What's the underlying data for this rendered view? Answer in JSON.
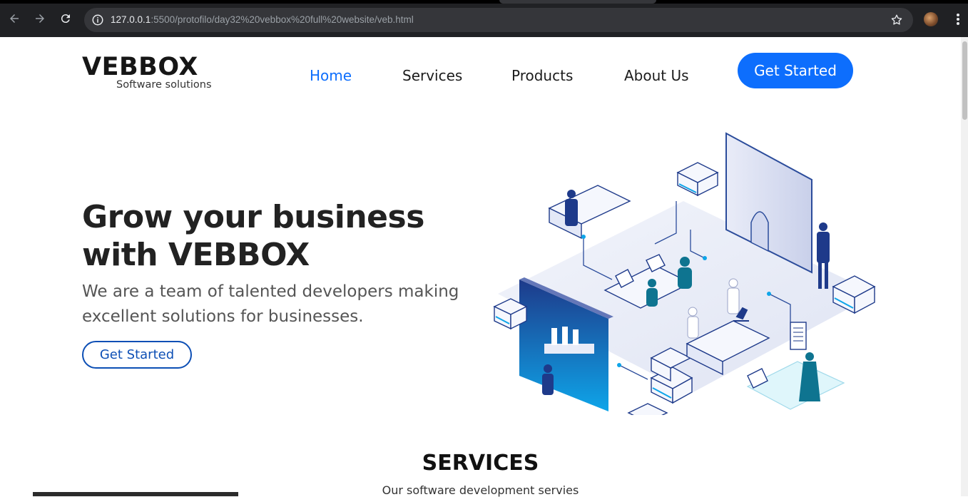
{
  "browser": {
    "url_host": "127.0.0.1",
    "url_rest": ":5500/protofilo/day32%20vebbox%20full%20website/veb.html",
    "icons": [
      "back-icon",
      "forward-icon",
      "reload-icon",
      "site-info-icon",
      "bookmark-star-icon",
      "profile-avatar",
      "menu-kebab-icon"
    ]
  },
  "logo": {
    "title": "VEBBOX",
    "subtitle": "Software solutions"
  },
  "nav": {
    "items": [
      {
        "label": "Home",
        "active": true
      },
      {
        "label": "Services",
        "active": false
      },
      {
        "label": "Products",
        "active": false
      },
      {
        "label": "About Us",
        "active": false
      }
    ],
    "cta": "Get Started"
  },
  "hero": {
    "title_line1": "Grow your business",
    "title_line2": "with VEBBOX",
    "subtitle": "We are a team of talented developers making excellent solutions for businesses.",
    "button": "Get Started"
  },
  "services": {
    "title": "SERVICES",
    "subtitle": "Our software development servies"
  },
  "colors": {
    "accent": "#0d6efd",
    "outline_button": "#0d4fb5",
    "heading": "#222222",
    "chrome_bg": "#202124"
  }
}
